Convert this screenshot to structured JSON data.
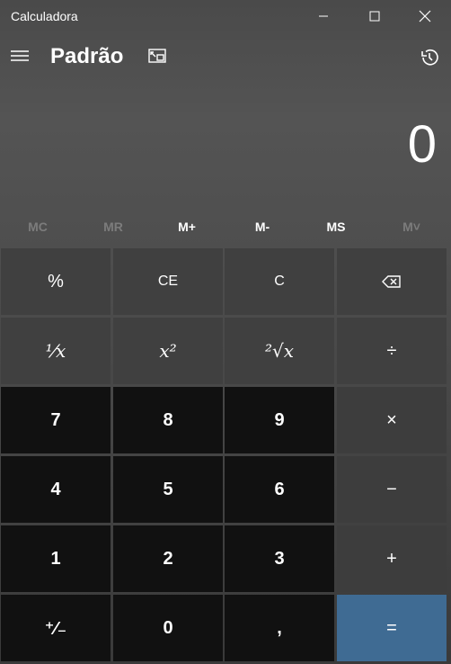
{
  "window": {
    "title": "Calculadora"
  },
  "header": {
    "mode": "Padrão"
  },
  "display": {
    "value": "0"
  },
  "memory": {
    "mc": "MC",
    "mr": "MR",
    "mplus": "M+",
    "mminus": "M-",
    "ms": "MS",
    "mlist": "M˅"
  },
  "keys": {
    "percent": "%",
    "ce": "CE",
    "c": "C",
    "reciprocal": "¹⁄x",
    "square": "x²",
    "sqrt": "²√x",
    "divide": "÷",
    "k7": "7",
    "k8": "8",
    "k9": "9",
    "multiply": "×",
    "k4": "4",
    "k5": "5",
    "k6": "6",
    "minus": "−",
    "k1": "1",
    "k2": "2",
    "k3": "3",
    "plus": "+",
    "negate": "⁺⁄₋",
    "k0": "0",
    "decimal": ",",
    "equals": "="
  },
  "colors": {
    "equals_accent": "#3f6b93",
    "number_key": "#111111",
    "function_key": "#404040"
  }
}
